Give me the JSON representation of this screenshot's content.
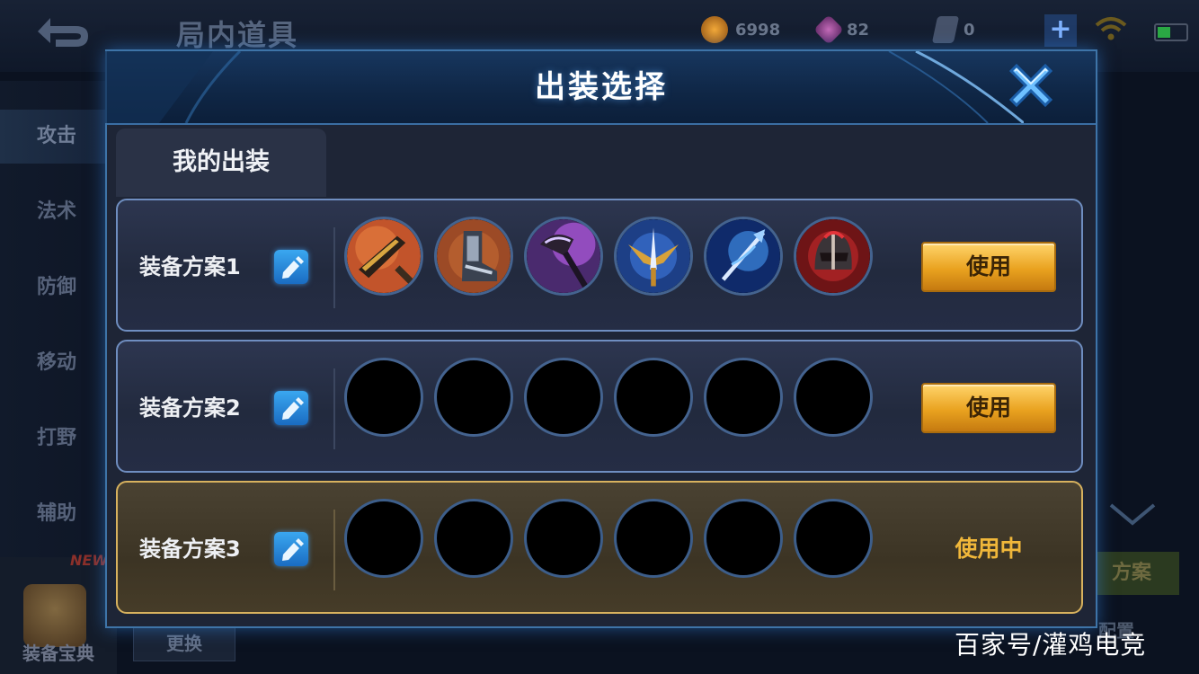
{
  "background": {
    "page_title": "局内道具",
    "resources": {
      "gold": "6998",
      "gems": "82",
      "cards": "0"
    },
    "sidebar": [
      "攻击",
      "法术",
      "防御",
      "移动",
      "打野",
      "辅助"
    ],
    "codex": {
      "badge": "NEW",
      "label": "装备宝典"
    },
    "swap_button": "更换",
    "right_button_partial": "方案",
    "right_bottom_partial": "配置"
  },
  "modal": {
    "title": "出装选择",
    "tab": "我的出装",
    "plans": [
      {
        "name": "装备方案1",
        "action": "使用",
        "items": [
          "orange-blade",
          "armored-boots",
          "purple-axe",
          "blue-winged-sword",
          "ice-spear",
          "red-helmet"
        ]
      },
      {
        "name": "装备方案2",
        "action": "使用",
        "items": [
          "",
          "",
          "",
          "",
          "",
          ""
        ]
      },
      {
        "name": "装备方案3",
        "action": "使用中",
        "items": [
          "",
          "",
          "",
          "",
          "",
          ""
        ]
      }
    ]
  },
  "watermark": "百家号/灌鸡电竞",
  "colors": {
    "accent_blue": "#3e74a8",
    "gold_button": "#e9a21f",
    "in_use_text": "#f0b73a"
  }
}
